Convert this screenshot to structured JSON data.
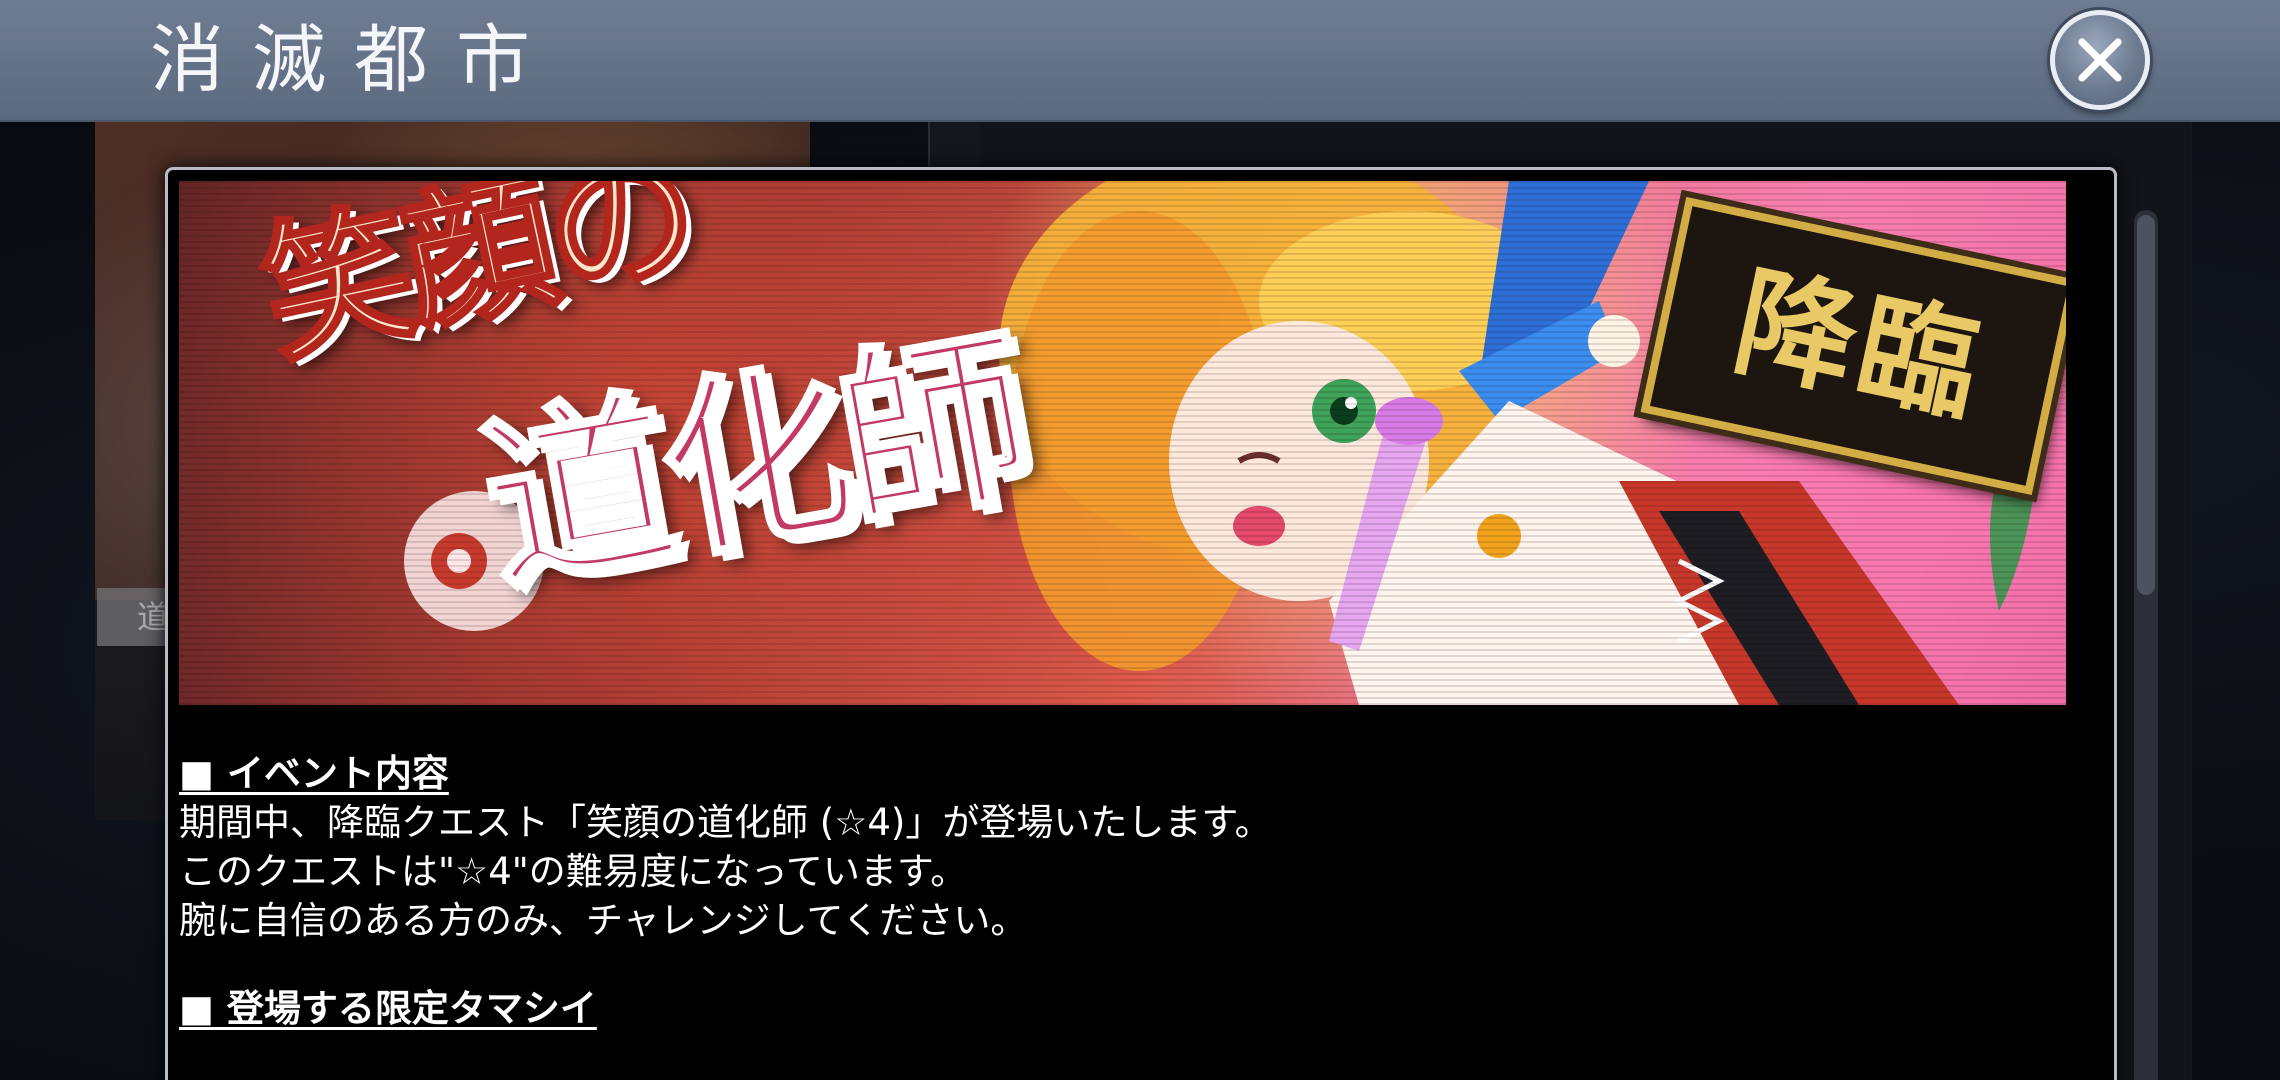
{
  "header": {
    "title": "消滅都市",
    "close_icon": "close-icon"
  },
  "background": {
    "left_tab_label": "道"
  },
  "banner": {
    "title_line1": "笑顔の",
    "title_line2": "道化師",
    "badge": "降臨"
  },
  "content": {
    "section1_heading": "■ イベント内容",
    "section1_lines": [
      "期間中、降臨クエスト「笑顔の道化師 (☆4)」が登場いたします。",
      "このクエストは\"☆4\"の難易度になっています。",
      "腕に自信のある方のみ、チャレンジしてください。"
    ],
    "section2_heading": "■ 登場する限定タマシイ"
  },
  "colors": {
    "header_bar": "#6f7c92",
    "modal_border": "#b9bcc3",
    "text": "#ffffff",
    "badge_gold": "#d2ad46"
  }
}
